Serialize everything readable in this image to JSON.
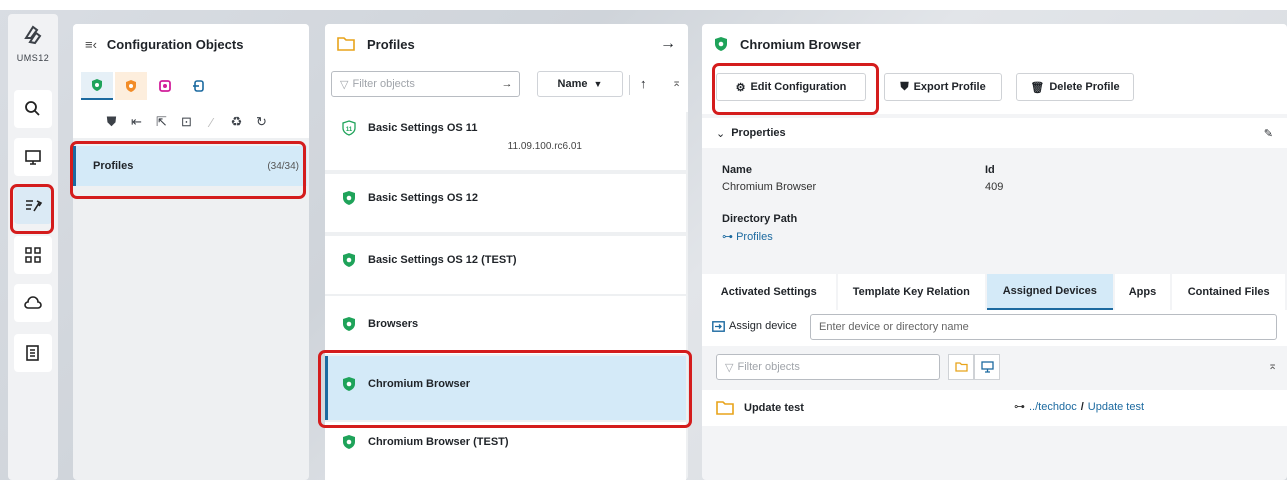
{
  "app": {
    "logo_text": "UMS12"
  },
  "rail": {
    "items": [
      {
        "name": "search-icon"
      },
      {
        "name": "monitor-icon"
      },
      {
        "name": "configuration-icon",
        "active": true
      },
      {
        "name": "apps-grid-icon"
      },
      {
        "name": "cloud-icon"
      },
      {
        "name": "document-icon"
      }
    ]
  },
  "config_panel": {
    "title": "Configuration Objects",
    "tree": {
      "label": "Profiles",
      "count": "(34/34)"
    }
  },
  "profiles_panel": {
    "title": "Profiles",
    "filter_placeholder": "Filter objects",
    "sort_label": "Name",
    "items": [
      {
        "label": "Basic Settings OS 11",
        "sub": "11.09.100.rc6.01",
        "icon": "os11-badge-icon"
      },
      {
        "label": "Basic Settings OS 12",
        "sub": "",
        "icon": "shield-icon"
      },
      {
        "label": "Basic Settings OS 12 (TEST)",
        "sub": "",
        "icon": "shield-icon"
      },
      {
        "label": "Browsers",
        "sub": "",
        "icon": "shield-icon"
      },
      {
        "label": "Chromium Browser",
        "sub": "",
        "icon": "shield-icon",
        "selected": true
      },
      {
        "label": "Chromium Browser (TEST)",
        "sub": "",
        "icon": "shield-icon"
      }
    ]
  },
  "detail_panel": {
    "title": "Chromium Browser",
    "buttons": {
      "edit": "Edit Configuration",
      "export": "Export Profile",
      "delete": "Delete Profile"
    },
    "properties_label": "Properties",
    "props": {
      "name_label": "Name",
      "name_value": "Chromium Browser",
      "id_label": "Id",
      "id_value": "409",
      "dir_label": "Directory Path",
      "dir_value": "Profiles"
    },
    "tabs": [
      "Activated Settings",
      "Template Key Relation",
      "Assigned Devices",
      "Apps",
      "Contained Files"
    ],
    "active_tab": "Assigned Devices",
    "assign_label": "Assign device",
    "assign_placeholder": "Enter device or directory name",
    "filter_placeholder": "Filter objects",
    "result": {
      "label": "Update test",
      "path_prefix": "../techdoc",
      "path_sep": "/",
      "path_name": "Update test"
    }
  },
  "colors": {
    "accent": "#1c6aa0",
    "selection": "#d4eaf8",
    "highlight": "#d41c1c",
    "shield": "#1fa35a"
  }
}
